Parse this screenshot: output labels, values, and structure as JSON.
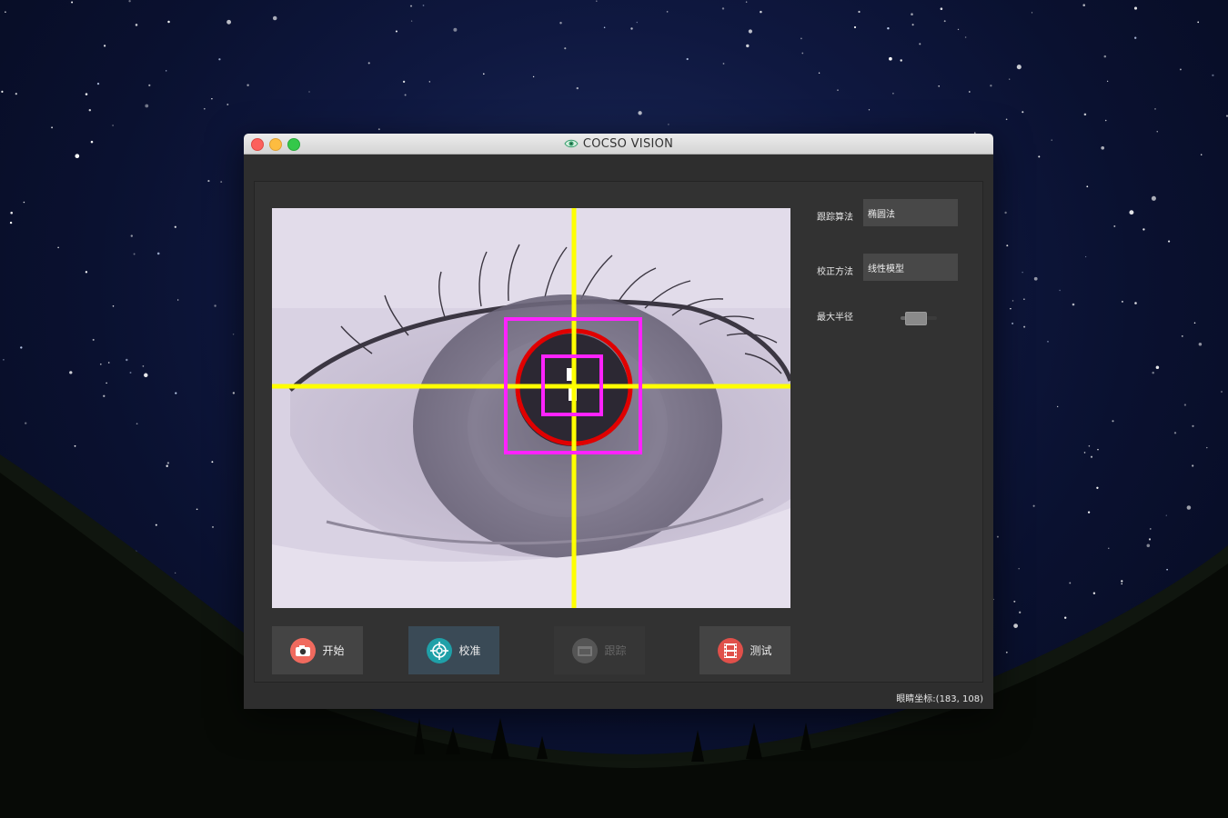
{
  "window": {
    "title": "COCSO VISION",
    "icon": "eye-icon"
  },
  "camera": {
    "overlay_colors": {
      "crosshair": "#ffff00",
      "face_box": "#ff22ff",
      "pupil_circle": "#e00000"
    }
  },
  "buttons": [
    {
      "label": "开始",
      "icon": "camera-icon",
      "icon_color": "#f06a5e",
      "state": "normal"
    },
    {
      "label": "校准",
      "icon": "target-icon",
      "icon_color": "#1fa0a8",
      "state": "active"
    },
    {
      "label": "跟踪",
      "icon": "folder-icon",
      "icon_color": "#555555",
      "state": "disabled"
    },
    {
      "label": "测试",
      "icon": "film-icon",
      "icon_color": "#e0504a",
      "state": "normal"
    }
  ],
  "params": {
    "tracking_algorithm": {
      "label": "跟踪算法",
      "value": "椭圆法"
    },
    "correction_method": {
      "label": "校正方法",
      "value": "线性模型"
    },
    "max_radius": {
      "label": "最大半径",
      "level": 0.3
    }
  },
  "status": {
    "eye_coords": "眼睛坐标:(183, 108)"
  }
}
